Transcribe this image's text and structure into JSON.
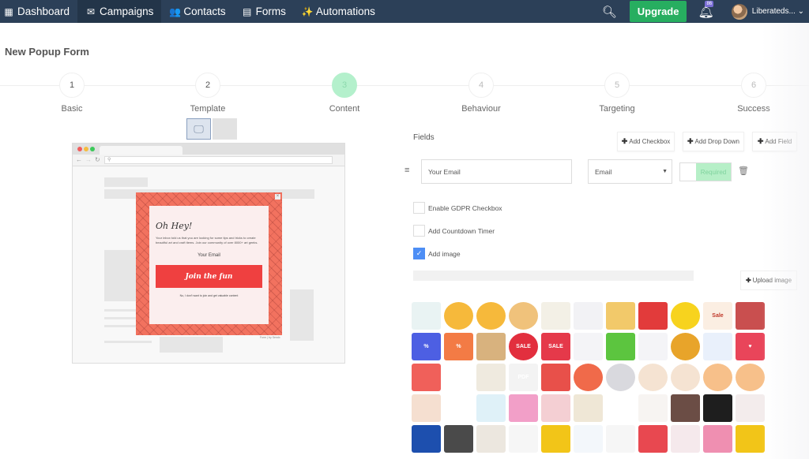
{
  "nav": {
    "items": [
      {
        "label": "Dashboard",
        "icon": "dashboard-icon",
        "glyph": "▦"
      },
      {
        "label": "Campaigns",
        "icon": "envelope-icon",
        "glyph": "✉"
      },
      {
        "label": "Contacts",
        "icon": "users-icon",
        "glyph": "👥"
      },
      {
        "label": "Forms",
        "icon": "form-icon",
        "glyph": "▤"
      },
      {
        "label": "Automations",
        "icon": "magic-wand-icon",
        "glyph": "✨"
      }
    ],
    "active": "Campaigns",
    "upgrade_label": "Upgrade",
    "notification_badge": "86",
    "user_name": "Liberateds...",
    "colors": {
      "bar": "#2c4058",
      "upgrade": "#27ae60"
    }
  },
  "page": {
    "title": "New Popup Form"
  },
  "steps": [
    {
      "number": "1",
      "label": "Basic",
      "state": "done"
    },
    {
      "number": "2",
      "label": "Template",
      "state": "done"
    },
    {
      "number": "3",
      "label": "Content",
      "state": "active"
    },
    {
      "number": "4",
      "label": "Behaviour",
      "state": "future"
    },
    {
      "number": "5",
      "label": "Targeting",
      "state": "future"
    },
    {
      "number": "6",
      "label": "Success",
      "state": "future"
    }
  ],
  "preview": {
    "device_options": [
      "desktop",
      "mobile"
    ],
    "selected_device": "desktop",
    "popup": {
      "heading": "Oh Hey!",
      "body": "Your inbox told us that you are looking for some tips and tricks to create beautiful art and craft items. Join our community of over 8000+ art geeks.",
      "email_placeholder": "Your Email",
      "button_label": "Join the fun",
      "decline_text": "No, I don't want to join and get valuable content",
      "powered_by": "Form | by Sendx",
      "close": "×",
      "colors": {
        "background": "#f2725f",
        "button": "#ef4040"
      }
    }
  },
  "fields": {
    "label": "Fields",
    "add_checkbox": "Add Checkbox",
    "add_dropdown": "Add Drop Down",
    "add_field": "Add Field",
    "rows": [
      {
        "placeholder": "Your Email",
        "type": "Email",
        "required_label": "Required",
        "required": true
      }
    ],
    "options": [
      {
        "label": "Enable GDPR Checkbox",
        "checked": false
      },
      {
        "label": "Add Countdown Timer",
        "checked": false
      },
      {
        "label": "Add image",
        "checked": true
      }
    ],
    "image_url_value": "",
    "upload_label": "Upload image"
  },
  "gallery": {
    "items": [
      {
        "name": "newspaper",
        "bg": "#e9f3f3",
        "fg": "#2e7d7d",
        "text": "",
        "round": false
      },
      {
        "name": "book",
        "bg": "#f6b93b",
        "fg": "",
        "text": "",
        "round": true
      },
      {
        "name": "books",
        "bg": "#f6b93b",
        "fg": "",
        "text": "",
        "round": true
      },
      {
        "name": "document-gear",
        "bg": "#f0c27b",
        "fg": "",
        "text": "",
        "round": true
      },
      {
        "name": "document-search",
        "bg": "#f3f0e6",
        "fg": "",
        "text": "",
        "round": false
      },
      {
        "name": "case-study",
        "bg": "#f2f2f5",
        "fg": "",
        "text": "",
        "round": false
      },
      {
        "name": "open-envelope",
        "bg": "#f2c96a",
        "fg": "",
        "text": "",
        "round": false
      },
      {
        "name": "red-envelope",
        "bg": "#e23b3b",
        "fg": "",
        "text": "",
        "round": false
      },
      {
        "name": "yellow-envelope",
        "bg": "#f7d31e",
        "fg": "",
        "text": "",
        "round": true
      },
      {
        "name": "sale-ribbon",
        "bg": "#fbeee2",
        "fg": "#c0392b",
        "text": "Sale",
        "round": false
      },
      {
        "name": "loyalty-cards",
        "bg": "#c94f4f",
        "fg": "",
        "text": "",
        "round": false
      },
      {
        "name": "shopping-bag",
        "bg": "#4d5fe3",
        "fg": "",
        "text": "%",
        "round": false
      },
      {
        "name": "discount-tag",
        "bg": "#f37b45",
        "fg": "",
        "text": "%",
        "round": false
      },
      {
        "name": "limited-stock-box",
        "bg": "#d8b27e",
        "fg": "",
        "text": "",
        "round": false
      },
      {
        "name": "sale-badge",
        "bg": "#e22f3e",
        "fg": "",
        "text": "SALE",
        "round": true
      },
      {
        "name": "sale-tag",
        "bg": "#e5394a",
        "fg": "",
        "text": "SALE",
        "round": false
      },
      {
        "name": "checklist",
        "bg": "#f4f4f7",
        "fg": "",
        "text": "",
        "round": false
      },
      {
        "name": "gift",
        "bg": "#5cc53f",
        "fg": "",
        "text": "",
        "round": false
      },
      {
        "name": "megaphone",
        "bg": "#f4f4f7",
        "fg": "",
        "text": "",
        "round": false
      },
      {
        "name": "cyber-monday",
        "bg": "#e8a42a",
        "fg": "",
        "text": "",
        "round": true
      },
      {
        "name": "notepad",
        "bg": "#e9f0fb",
        "fg": "",
        "text": "",
        "round": false
      },
      {
        "name": "heart-chat",
        "bg": "#e9455a",
        "fg": "",
        "text": "♥",
        "round": false
      },
      {
        "name": "brain",
        "bg": "#f0605a",
        "fg": "",
        "text": "",
        "round": false
      },
      {
        "name": "paper-plane",
        "bg": "#ffffff",
        "fg": "",
        "text": "",
        "round": false
      },
      {
        "name": "newsletter",
        "bg": "#efeadf",
        "fg": "",
        "text": "",
        "round": false
      },
      {
        "name": "pdf",
        "bg": "#f3f3f3",
        "fg": "",
        "text": "PDF",
        "round": false
      },
      {
        "name": "gift-box",
        "bg": "#e8504a",
        "fg": "",
        "text": "",
        "round": false
      },
      {
        "name": "planet",
        "bg": "#f06a4a",
        "fg": "",
        "text": "",
        "round": true
      },
      {
        "name": "raccoon",
        "bg": "#d9d9de",
        "fg": "",
        "text": "",
        "round": true
      },
      {
        "name": "man-glasses",
        "bg": "#f5e3d2",
        "fg": "",
        "text": "",
        "round": true
      },
      {
        "name": "woman",
        "bg": "#f5e3d2",
        "fg": "",
        "text": "",
        "round": true
      },
      {
        "name": "man-avatar",
        "bg": "#f7c08a",
        "fg": "",
        "text": "",
        "round": true
      },
      {
        "name": "boy-avatar",
        "bg": "#f7c08a",
        "fg": "",
        "text": "",
        "round": true
      },
      {
        "name": "man-orange",
        "bg": "#f5dfd0",
        "fg": "",
        "text": "",
        "round": false
      },
      {
        "name": "pacman",
        "bg": "#ffffff",
        "fg": "",
        "text": "",
        "round": false
      },
      {
        "name": "hearts",
        "bg": "#dff1f8",
        "fg": "",
        "text": "",
        "round": false
      },
      {
        "name": "dino",
        "bg": "#f29fc8",
        "fg": "",
        "text": "",
        "round": false
      },
      {
        "name": "baby",
        "bg": "#f4cfd3",
        "fg": "",
        "text": "",
        "round": false
      },
      {
        "name": "pattern",
        "bg": "#efe7d6",
        "fg": "",
        "text": "",
        "round": false
      },
      {
        "name": "black-fluff",
        "bg": "#ffffff",
        "fg": "",
        "text": "",
        "round": false
      },
      {
        "name": "floral-frame",
        "bg": "#f7f4f2",
        "fg": "",
        "text": "",
        "round": false
      },
      {
        "name": "round-frame",
        "bg": "#6b4d45",
        "fg": "",
        "text": "",
        "round": false
      },
      {
        "name": "yellow-frame",
        "bg": "#1e1e1e",
        "fg": "",
        "text": "",
        "round": false
      },
      {
        "name": "flowers",
        "bg": "#f3ecec",
        "fg": "",
        "text": "",
        "round": false
      },
      {
        "name": "blue-stars",
        "bg": "#1d4fae",
        "fg": "",
        "text": "",
        "round": false
      },
      {
        "name": "desk",
        "bg": "#4a4a4a",
        "fg": "",
        "text": "",
        "round": false
      },
      {
        "name": "gift-tags",
        "bg": "#ece7df",
        "fg": "",
        "text": "",
        "round": false
      },
      {
        "name": "confetti",
        "bg": "#f6f6f6",
        "fg": "",
        "text": "",
        "round": false
      },
      {
        "name": "yellow-plain",
        "bg": "#f2c518",
        "fg": "",
        "text": "",
        "round": false
      },
      {
        "name": "bunting",
        "bg": "#f3f7fb",
        "fg": "",
        "text": "",
        "round": false
      },
      {
        "name": "woman-standing",
        "bg": "#f6f6f6",
        "fg": "",
        "text": "",
        "round": false
      },
      {
        "name": "man-red",
        "bg": "#e84850",
        "fg": "",
        "text": "",
        "round": false
      },
      {
        "name": "pink-shape",
        "bg": "#f5e9ec",
        "fg": "",
        "text": "",
        "round": false
      },
      {
        "name": "pixels",
        "bg": "#ef8fb1",
        "fg": "",
        "text": "",
        "round": false
      },
      {
        "name": "lamp",
        "bg": "#f2c518",
        "fg": "",
        "text": "",
        "round": false
      }
    ]
  }
}
